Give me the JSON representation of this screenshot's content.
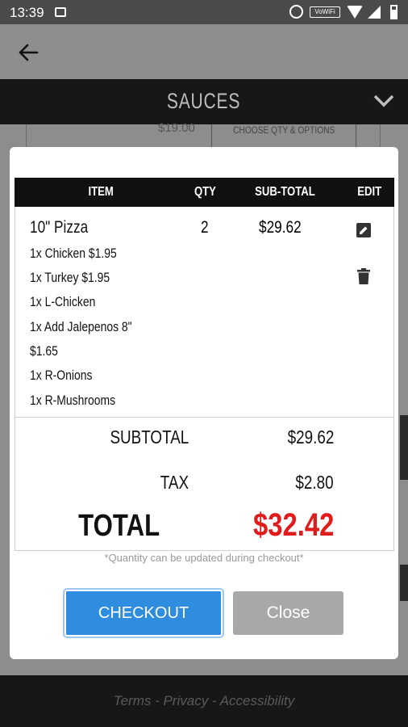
{
  "status_bar": {
    "time": "13:39",
    "vowifi": "VoWiFi"
  },
  "category_bar": {
    "title": "SAUCES"
  },
  "background": {
    "price": "$19.00",
    "options_button": "CHOOSE QTY & OPTIONS"
  },
  "cart": {
    "columns": [
      "ITEM",
      "QTY",
      "SUB-TOTAL",
      "EDIT"
    ],
    "items": [
      {
        "name": "10\" Pizza",
        "qty": "2",
        "subtotal": "$29.62",
        "options": [
          "1x Chicken $1.95",
          "1x Turkey $1.95",
          "1x L-Chicken",
          "1x Add Jalepenos 8\"",
          "$1.65",
          "1x R-Onions",
          "1x R-Mushrooms"
        ]
      }
    ],
    "summary": {
      "subtotal_label": "SUBTOTAL",
      "subtotal_value": "$29.62",
      "tax_label": "TAX",
      "tax_value": "$2.80",
      "total_label": "TOTAL",
      "total_value": "$32.42"
    },
    "note": "*Quantity can be updated during checkout*",
    "checkout_label": "CHECKOUT",
    "close_label": "Close"
  },
  "footer": {
    "links": "Terms - Privacy - Accessibility"
  },
  "colors": {
    "checkout": "#2f8de0",
    "total": "#e01b1b",
    "header": "#111111"
  }
}
